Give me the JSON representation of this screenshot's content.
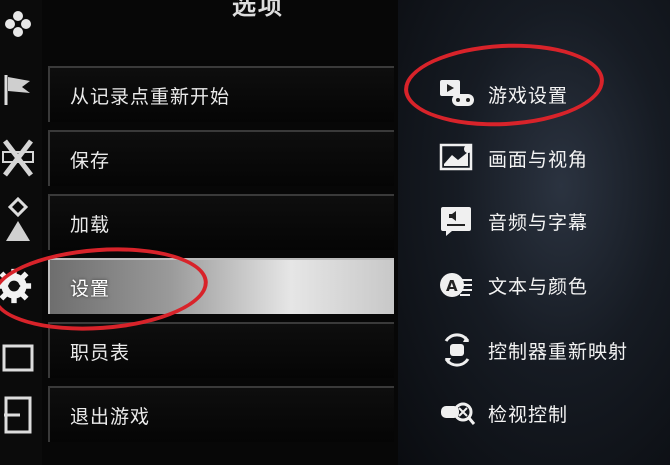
{
  "menu": {
    "title": "选项",
    "items": [
      {
        "label": "从记录点重新开始"
      },
      {
        "label": "保存"
      },
      {
        "label": "加载"
      },
      {
        "label": "设置",
        "selected": true
      },
      {
        "label": "职员表"
      },
      {
        "label": "退出游戏"
      }
    ]
  },
  "settings_menu": {
    "items": [
      {
        "label": "游戏设置",
        "icon": "gamepad-monitor-icon"
      },
      {
        "label": "画面与视角",
        "icon": "display-icon"
      },
      {
        "label": "音频与字幕",
        "icon": "audio-subtitle-icon"
      },
      {
        "label": "文本与颜色",
        "icon": "text-color-icon"
      },
      {
        "label": "控制器重新映射",
        "icon": "controller-remap-icon"
      },
      {
        "label": "检视控制",
        "icon": "inspect-control-icon"
      }
    ]
  },
  "colors": {
    "annotation": "#d8232a",
    "selected_gradient_end": "#e6e6e6"
  }
}
